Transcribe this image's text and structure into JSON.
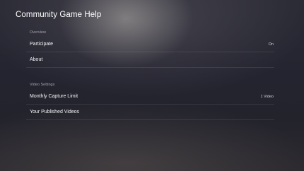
{
  "header": {
    "title": "Community Game Help"
  },
  "sections": [
    {
      "header": "Overview",
      "items": [
        {
          "label": "Participate",
          "value": "On"
        },
        {
          "label": "About",
          "value": ""
        }
      ]
    },
    {
      "header": "Video Settings",
      "items": [
        {
          "label": "Monthly Capture Limit",
          "value": "1 Video"
        },
        {
          "label": "Your Published Videos",
          "value": ""
        }
      ]
    }
  ]
}
